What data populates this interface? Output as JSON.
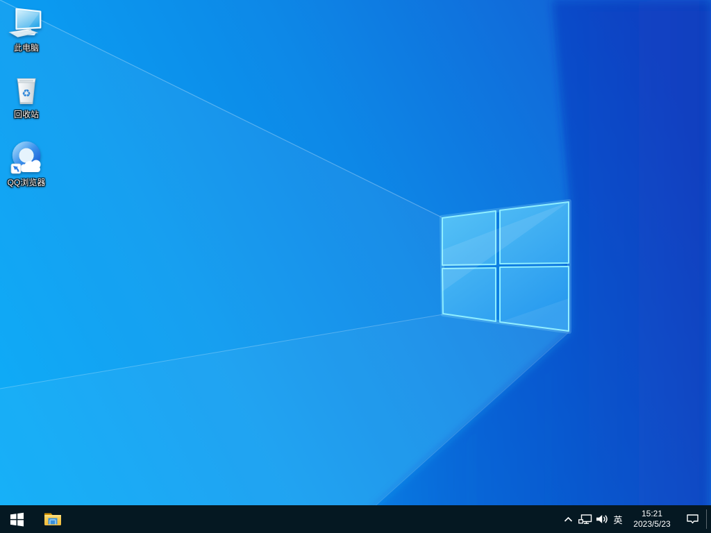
{
  "wallpaper": {
    "description": "windows-10-default-light-ray-wallpaper",
    "base_left_color": "#00aaf8",
    "base_right_color": "#1042c3",
    "logo_stroke_color": "#8feeff"
  },
  "desktop": {
    "icons": [
      {
        "id": "this-pc",
        "label": "此电脑"
      },
      {
        "id": "recycle-bin",
        "label": "回收站"
      },
      {
        "id": "qq-browser",
        "label": "QQ浏览器"
      }
    ],
    "recycle_glyph": "♻"
  },
  "taskbar": {
    "background_color": "#051822",
    "start_icon": "windows-flag",
    "pinned": [
      {
        "id": "file-explorer",
        "icon": "yellow-folder"
      }
    ],
    "tray": {
      "hidden_icons_icon": "chevron-up",
      "network_icon": "ethernet-monitor",
      "volume_icon": "speaker-waves",
      "ime_label": "英",
      "clock": {
        "time": "15:21",
        "date": "2023/5/23"
      },
      "action_center_icon": "notification-bubble"
    }
  }
}
